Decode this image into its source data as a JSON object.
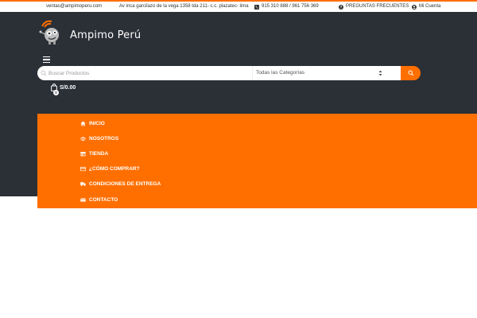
{
  "topbar": {
    "email": "ventas@ampimoperu.com",
    "address": "Av inca garcilazo de la vega 1358 tda 211- c.c. plazatec- lima",
    "phone": "915 310 888 / 961 756 369",
    "faq": "PREGUNTAS FRECUENTES",
    "account": "Mi Cuenta"
  },
  "brand": {
    "name": "Ampimo Perú"
  },
  "search": {
    "placeholder": "Buscar Productos",
    "category": "Todas las Categorías"
  },
  "cart": {
    "total": "S/0.00",
    "count": "0"
  },
  "menu": {
    "items": [
      {
        "label": "INICIO",
        "icon": "home-icon"
      },
      {
        "label": "NOSOTROS",
        "icon": "users-icon"
      },
      {
        "label": "TIENDA",
        "icon": "store-icon"
      },
      {
        "label": "¿CÓMO COMPRAR?",
        "icon": "credit-card-icon"
      },
      {
        "label": "CONDICIONES DE ENTREGA",
        "icon": "truck-icon"
      },
      {
        "label": "CONTACTO",
        "icon": "envelope-icon"
      }
    ]
  },
  "colors": {
    "accent": "#ff6f00",
    "header_bg": "#2b2f36"
  }
}
